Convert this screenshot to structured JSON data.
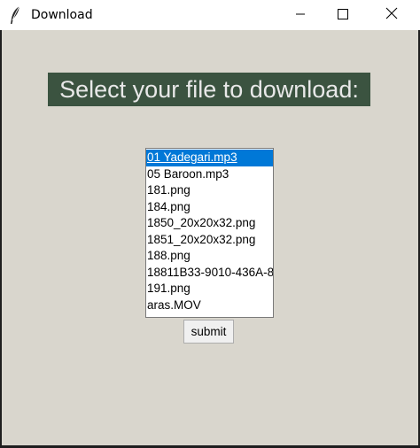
{
  "window": {
    "title": "Download",
    "icon": "feather-icon",
    "controls": {
      "minimize": "minimize-icon",
      "maximize": "maximize-icon",
      "close": "close-icon"
    }
  },
  "main": {
    "heading": "Select your file to download:",
    "heading_bg": "#3b5340",
    "files": [
      "01 Yadegari.mp3",
      "05 Baroon.mp3",
      "181.png",
      "184.png",
      "1850_20x20x32.png",
      "1851_20x20x32.png",
      "188.png",
      "18811B33-9010-436A-8",
      "191.png",
      "aras.MOV"
    ],
    "selected_file": "01 Yadegari.mp3",
    "submit_label": "submit"
  },
  "colors": {
    "client_bg": "#d9d6cd",
    "selection": "#0078d7"
  }
}
